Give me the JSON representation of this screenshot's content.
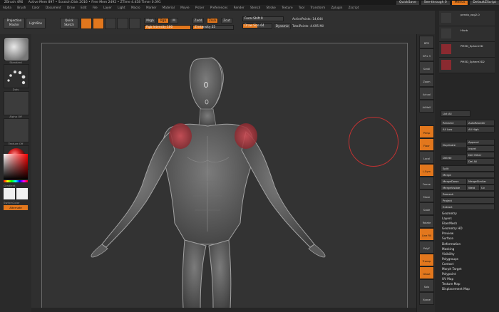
{
  "title_bar": {
    "app": "ZBrush 4R6",
    "info": "Active Mem 897 • Scratch Disk 2016 • Free Mem 2492 • ZTime 4.458 Timer 0.091",
    "quicksave": "QuickSave",
    "see_through": "See-through 0",
    "menus_btn": "Menus",
    "default_script": "DefaultZScript"
  },
  "menu_bar": [
    "Alpha",
    "Brush",
    "Color",
    "Document",
    "Draw",
    "Edit",
    "File",
    "Layer",
    "Light",
    "Macro",
    "Marker",
    "Material",
    "Movie",
    "Picker",
    "Preferences",
    "Render",
    "Stencil",
    "Stroke",
    "Texture",
    "Tool",
    "Transform",
    "Zplugin",
    "Zscript"
  ],
  "toolbar": {
    "projection_master": "Projection Master",
    "lightbox": "LightBox",
    "quick_sketch": "Quick Sketch",
    "edit": "Edit",
    "draw": "Draw",
    "move": "Move",
    "scale": "Scale",
    "rotate": "Rotate",
    "mrgb": "Mrgb",
    "rgb": "Rgb",
    "m": "M",
    "zadd": "Zadd",
    "zsub": "Zsub",
    "zcut": "Zcut",
    "rgb_intensity": "Rgb Intensity 100",
    "z_intensity": "Z Intensity 25",
    "focal_shift": "Focal Shift 0",
    "draw_size": "Draw Size 64",
    "dynamic": "Dynamic",
    "active_points": "ActivePoints: 14,644",
    "total_points": "TotalPoints: 4.695 Mil"
  },
  "left_shelf": {
    "brush": "Standard",
    "stroke": "Dots",
    "alpha": "Alpha Off",
    "texture": "Texture Off",
    "material": "MatCap Red",
    "gradient": "Gradient",
    "switch_color": "SwitchColor",
    "alternate": "Alternate"
  },
  "right_tools": [
    "BPR",
    "SPix 3",
    "Scroll",
    "Zoom",
    "Actual",
    "AAHalf",
    "Persp",
    "Floor",
    "Local",
    "L.Sym",
    "Frame",
    "Move",
    "Scale",
    "Rotate",
    "Line Fill",
    "PolyF",
    "Transp",
    "Ghost",
    "Solo",
    "Xpose"
  ],
  "subtools": [
    {
      "name": "pendo_vag2.0"
    },
    {
      "name": "Hlurb"
    },
    {
      "name": "PM3D_Sphere3D"
    },
    {
      "name": "PM3D_Sphere3D2"
    }
  ],
  "subtool_panel": {
    "list_all": "List All",
    "rename": "Rename",
    "auto_reorder": "AutoReorder",
    "all_low": "All Low",
    "all_high": "All High",
    "duplicate": "Duplicate",
    "append": "Append",
    "insert": "Insert",
    "delete": "Delete",
    "del_other": "Del Other",
    "del_all": "Del All",
    "split": "Split",
    "merge": "Merge",
    "merge_down": "MergeDown",
    "merge_similar": "MergeSimilar",
    "merge_visible": "MergeVisible",
    "weld": "Weld",
    "uv": "Uv",
    "remesh": "Remesh",
    "project": "Project",
    "extract": "Extract"
  },
  "tool_menu": [
    "Geometry",
    "Layers",
    "FiberMesh",
    "Geometry HD",
    "Preview",
    "Surface",
    "Deformation",
    "Masking",
    "Visibility",
    "Polygroups",
    "Contact",
    "Morph Target",
    "Polypaint",
    "UV Map",
    "Texture Map",
    "Displacement Map"
  ],
  "colors": {
    "accent": "#e2771d",
    "brush_ring": "#c03232",
    "mask_red": "#b8333a"
  }
}
